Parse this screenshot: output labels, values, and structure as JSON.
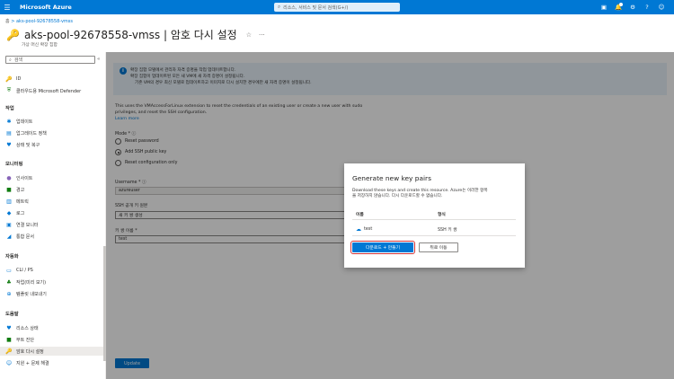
{
  "topbar": {
    "brand": "Microsoft Azure",
    "search_placeholder": "리소스, 서비스 및 문서 검색(G+/)"
  },
  "breadcrumb": {
    "item": "aks-pool-92678558-vmss"
  },
  "header": {
    "title": "aks-pool-92678558-vmss | 암호 다시 설정",
    "subtitle": "가상 머신 확장 집합"
  },
  "sidebar": {
    "search_placeholder": "검색",
    "items_top": [
      {
        "label": "ID",
        "icon": "id-icon"
      },
      {
        "label": "클라우드용 Microsoft Defender",
        "icon": "defender-icon"
      }
    ],
    "sections": [
      {
        "title": "작업",
        "items": [
          "업데이트",
          "업그레이드 정책",
          "상태 및 복구"
        ]
      },
      {
        "title": "모니터링",
        "items": [
          "인사이트",
          "경고",
          "메트릭",
          "로그",
          "연결 모니터",
          "통합 문서"
        ]
      },
      {
        "title": "자동화",
        "items": [
          "CLI / PS",
          "작업(미리 보기)",
          "템플릿 내보내기"
        ]
      },
      {
        "title": "도움말",
        "items": [
          "리소스 상태",
          "부트 진단",
          "암호 다시 설정",
          "지원 + 문제 해결"
        ]
      }
    ]
  },
  "main": {
    "info_lines": [
      "확장 집합 모델에서 관리자 자격 증명을 작업 업데이트합니다.",
      "확장 집합이 업데이트된 모든 새 VM에 새 자격 증명이 설정됩니다.",
      "기존 VM의 경우 최신 모델로 업데이트하고 이미지로 다시 설치한 경우에만 새 자격 증명이 설정됩니다."
    ],
    "desc1": "This uses the VMAccessForLinux extension to reset the credentials of an existing user or create a new user with sudo",
    "desc2": "privileges, and reset the SSH configuration.",
    "learn_more": "Learn more",
    "mode_label": "Mode *",
    "modes": [
      "Reset password",
      "Add SSH public key",
      "Reset configuration only"
    ],
    "username_label": "Username *",
    "username_value": "azureuser",
    "ssh_source_label": "SSH 공개 키 원본",
    "ssh_source_value": "새 키 쌍 생성",
    "keypair_label": "키 쌍 이름 *",
    "keypair_value": "test",
    "update_button": "Update"
  },
  "dialog": {
    "title": "Generate new key pairs",
    "desc_line1": "Download these keys and create this resource. Azure는 이러한 항목",
    "desc_line2": "을 저장하지 않습니다. 다시 다운로드할 수 없습니다.",
    "col_name": "이름",
    "col_type": "형식",
    "row_name": "test",
    "row_type": "SSH 키 쌍",
    "primary_button": "다운로드 + 만들기",
    "secondary_button": "뒤로 이동"
  }
}
